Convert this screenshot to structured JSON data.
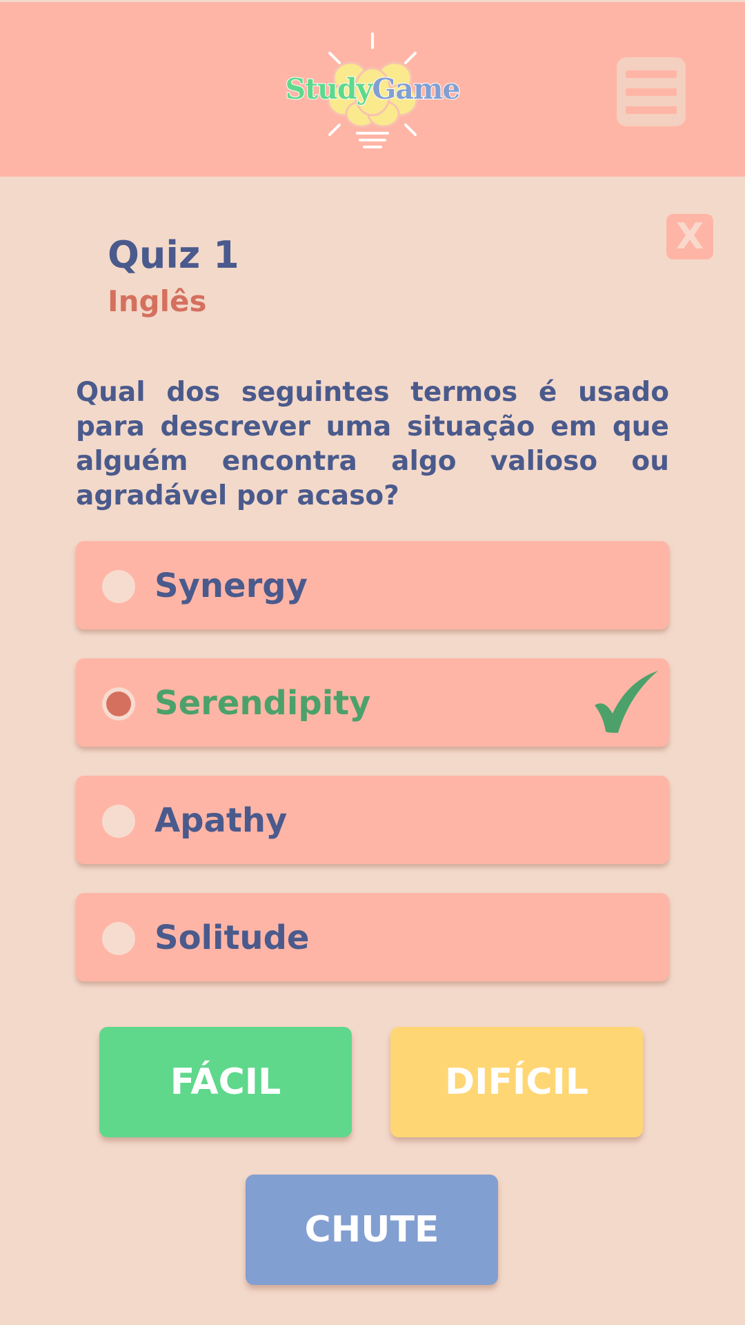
{
  "header": {
    "logo": {
      "text_study": "Study",
      "text_game": "Game",
      "icon": "brain-lightbulb-icon"
    },
    "menu_icon": "hamburger-menu-icon"
  },
  "quiz": {
    "close_label": "X",
    "title": "Quiz 1",
    "subject": "Inglês",
    "question": "Qual dos seguintes termos é usado para descrever uma situação em que alguém encontra algo valioso ou agradável por acaso?",
    "options": [
      {
        "label": "Synergy",
        "selected": false,
        "correct": false
      },
      {
        "label": "Serendipity",
        "selected": true,
        "correct": true
      },
      {
        "label": "Apathy",
        "selected": false,
        "correct": false
      },
      {
        "label": "Solitude",
        "selected": false,
        "correct": false
      }
    ]
  },
  "actions": {
    "easy_label": "FÁCIL",
    "hard_label": "DIFÍCIL",
    "guess_label": "CHUTE"
  },
  "colors": {
    "background": "#f3d9ca",
    "header": "#ffb5a6",
    "primary_text": "#4a5a8c",
    "accent": "#d5705e",
    "correct": "#4ca16a",
    "easy": "#5fd88c",
    "hard": "#ffd674",
    "guess": "#829fd1"
  }
}
